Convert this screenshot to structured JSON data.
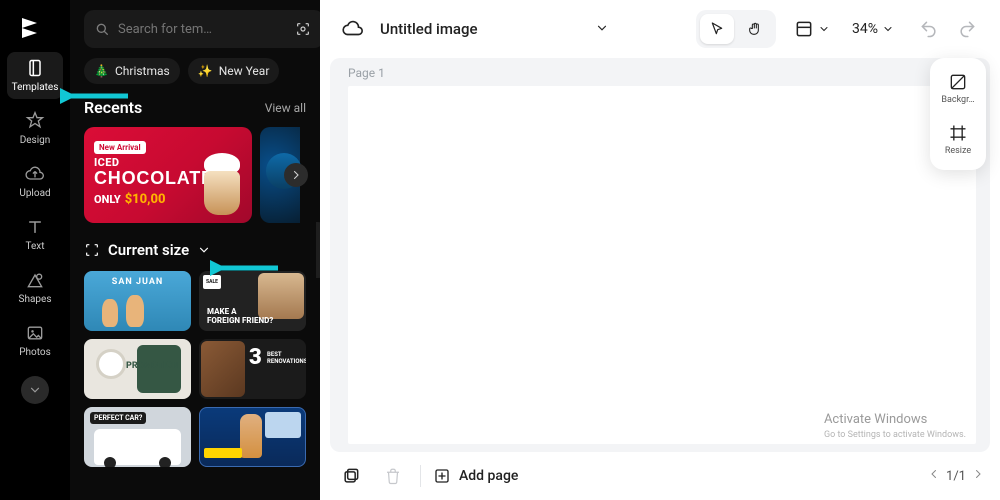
{
  "brand": "CapCut",
  "nav": [
    {
      "id": "templates",
      "label": "Templates",
      "active": true
    },
    {
      "id": "design",
      "label": "Design",
      "active": false
    },
    {
      "id": "upload",
      "label": "Upload",
      "active": false
    },
    {
      "id": "text",
      "label": "Text",
      "active": false
    },
    {
      "id": "shapes",
      "label": "Shapes",
      "active": false
    },
    {
      "id": "photos",
      "label": "Photos",
      "active": false
    }
  ],
  "sidepanel": {
    "search_placeholder": "Search for tem…",
    "chips": [
      {
        "emoji": "🎄",
        "label": "Christmas"
      },
      {
        "emoji": "✨",
        "label": "New Year"
      }
    ],
    "recents": {
      "title": "Recents",
      "view_all": "View all",
      "choc": {
        "tag": "New Arrival",
        "line1": "ICED",
        "line2": "CHOCOLATE",
        "only": "ONLY",
        "price": "$10,00"
      }
    },
    "current_size": {
      "label": "Current size"
    },
    "cards": {
      "sanjuan": "SAN JUAN",
      "friend": {
        "sale": "SALE",
        "line1": "MAKE A",
        "line2": "FOREIGN FRIEND?"
      },
      "promotion": "PROMOTION",
      "three": {
        "num": "3",
        "sub": "BEST\nRENOVATIONS"
      },
      "perfect": "PERFECT CAR?"
    }
  },
  "topbar": {
    "title": "Untitled image",
    "zoom": "34%"
  },
  "right_tools": {
    "background": "Backgr…",
    "resize": "Resize"
  },
  "canvas": {
    "page_label": "Page 1"
  },
  "bottombar": {
    "add_page": "Add page",
    "pages": "1/1"
  },
  "watermark": {
    "line1": "Activate Windows",
    "line2": "Go to Settings to activate Windows."
  }
}
